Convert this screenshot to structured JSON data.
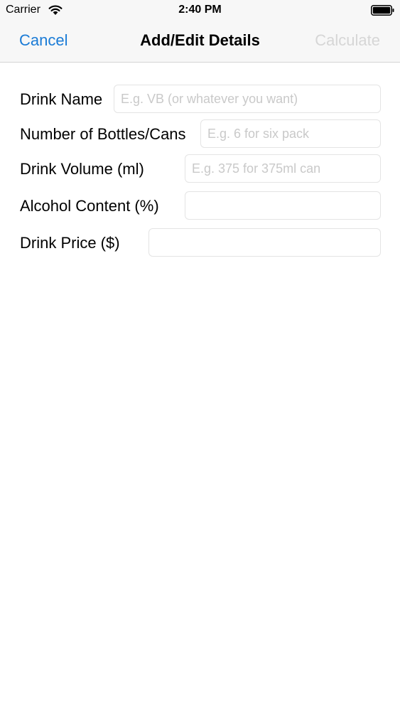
{
  "status_bar": {
    "carrier": "Carrier",
    "time": "2:40 PM",
    "wifi_icon": "wifi-icon",
    "battery_icon": "battery-icon"
  },
  "nav": {
    "cancel_label": "Cancel",
    "title": "Add/Edit Details",
    "calculate_label": "Calculate",
    "calculate_enabled": false,
    "accent_color": "#1a7bd6",
    "disabled_color": "#d6d6d6"
  },
  "form": {
    "fields": [
      {
        "label": "Drink Name",
        "value": "",
        "placeholder": "E.g. VB (or whatever you want)"
      },
      {
        "label": "Number of Bottles/Cans",
        "value": "",
        "placeholder": "E.g. 6 for six pack"
      },
      {
        "label": "Drink Volume (ml)",
        "value": "",
        "placeholder": "E.g. 375 for 375ml can"
      },
      {
        "label": "Alcohol Content (%)",
        "value": "",
        "placeholder": ""
      },
      {
        "label": "Drink Price ($)",
        "value": "",
        "placeholder": ""
      }
    ]
  }
}
